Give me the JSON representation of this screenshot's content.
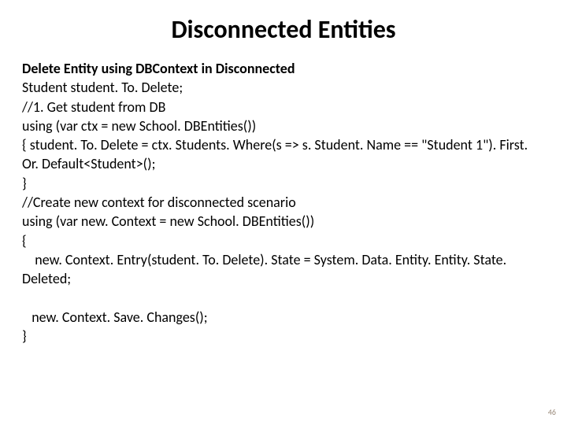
{
  "title": "Disconnected Entities",
  "subtitle": "Delete Entity using DBContext in Disconnected",
  "lines": {
    "l1": "Student student. To. Delete;",
    "l2": "//1. Get student from DB",
    "l3": "using (var ctx = new School. DBEntities())",
    "l4": "{   student. To. Delete = ctx. Students. Where(s => s. Student. Name == \"Student 1\"). First. Or. Default<Student>();",
    "l5": "}",
    "l6": "//Create new context for disconnected scenario",
    "l7": "using (var new. Context = new School. DBEntities())",
    "l8": "{",
    "l9": "    new. Context. Entry(student. To. Delete). State = System. Data. Entity. Entity. State. Deleted;",
    "l10": " ",
    "l11": "   new. Context. Save. Changes();",
    "l12": "}"
  },
  "pageNumber": "46"
}
